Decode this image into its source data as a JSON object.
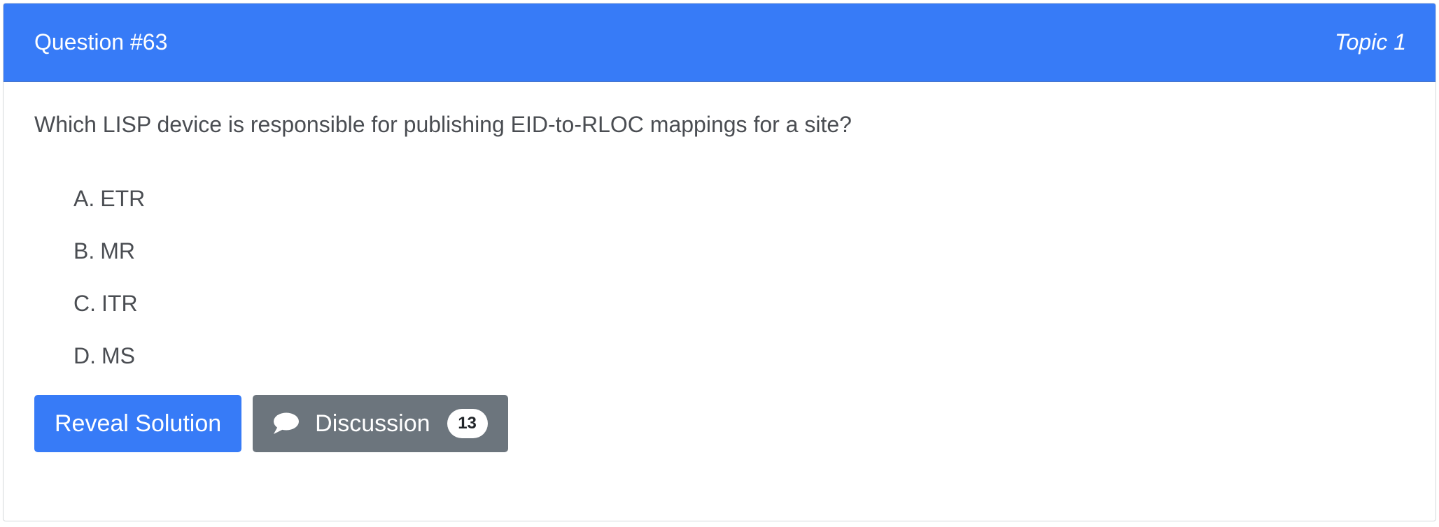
{
  "header": {
    "question_label": "Question #63",
    "topic_label": "Topic 1",
    "background_color": "#377bf7"
  },
  "question": {
    "text": "Which LISP device is responsible for publishing EID-to-RLOC mappings for a site?",
    "choices": [
      {
        "letter": "A.",
        "text": "ETR"
      },
      {
        "letter": "B.",
        "text": "MR"
      },
      {
        "letter": "C.",
        "text": "ITR"
      },
      {
        "letter": "D.",
        "text": "MS"
      }
    ]
  },
  "actions": {
    "reveal_label": "Reveal Solution",
    "discussion_label": "Discussion",
    "discussion_count": "13",
    "discussion_icon": "speech-bubble-icon"
  }
}
